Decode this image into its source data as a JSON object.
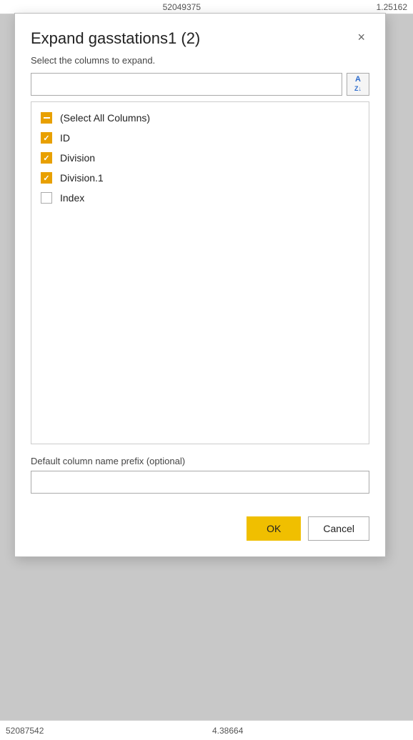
{
  "background": {
    "top_row": {
      "cell1": "52049375",
      "cell2": "1.25162"
    },
    "bottom_row": {
      "cell1": "52087542",
      "cell2": "4.38664"
    }
  },
  "modal": {
    "title": "Expand gasstations1 (2)",
    "subtitle": "Select the columns to expand.",
    "close_label": "×",
    "search_placeholder": "",
    "sort_icon_text": "A↓Z",
    "columns": [
      {
        "id": "select-all",
        "label": "(Select All Columns)",
        "state": "indeterminate"
      },
      {
        "id": "col-id",
        "label": "ID",
        "state": "checked"
      },
      {
        "id": "col-division",
        "label": "Division",
        "state": "checked"
      },
      {
        "id": "col-division1",
        "label": "Division.1",
        "state": "checked"
      },
      {
        "id": "col-index",
        "label": "Index",
        "state": "unchecked"
      }
    ],
    "prefix_label": "Default column name prefix (optional)",
    "prefix_value": "",
    "ok_label": "OK",
    "cancel_label": "Cancel"
  }
}
